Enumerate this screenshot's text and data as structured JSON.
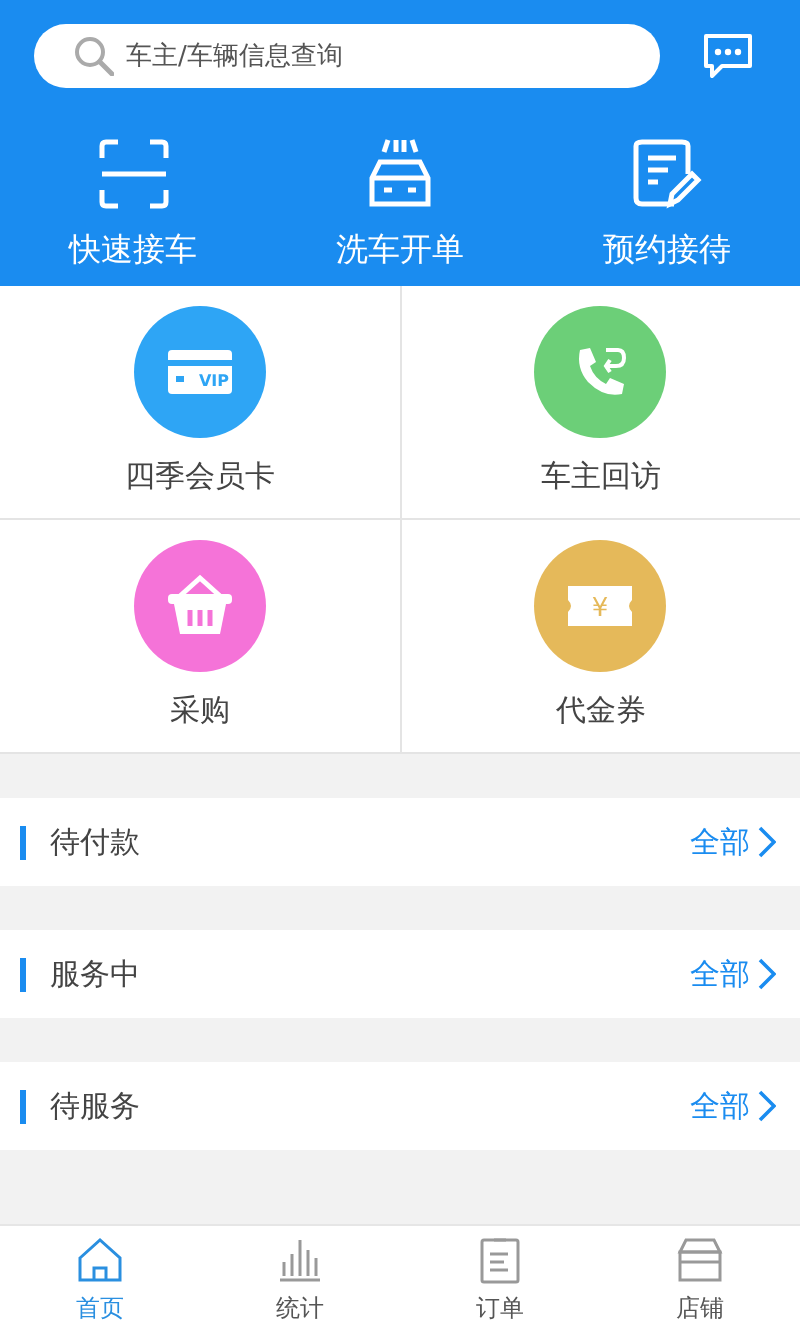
{
  "search": {
    "placeholder": "车主/车辆信息查询"
  },
  "quick_actions": [
    {
      "kind": "scan",
      "label": "快速接车"
    },
    {
      "kind": "carwash",
      "label": "洗车开单"
    },
    {
      "kind": "note",
      "label": "预约接待"
    }
  ],
  "grid": [
    {
      "kind": "vip",
      "label": "四季会员卡",
      "color": "#2ea5f5",
      "icon_text": "VIP"
    },
    {
      "kind": "phone",
      "label": "车主回访",
      "color": "#6ccf78"
    },
    {
      "kind": "basket",
      "label": "采购",
      "color": "#f573d8"
    },
    {
      "kind": "coupon",
      "label": "代金券",
      "color": "#e5b95a",
      "icon_text": "¥"
    }
  ],
  "sections": [
    {
      "title": "待付款",
      "link": "全部"
    },
    {
      "title": "服务中",
      "link": "全部"
    },
    {
      "title": "待服务",
      "link": "全部"
    }
  ],
  "tab_bar": [
    {
      "kind": "home",
      "label": "首页",
      "selected": true
    },
    {
      "kind": "stats",
      "label": "统计",
      "selected": false
    },
    {
      "kind": "order",
      "label": "订单",
      "selected": false
    },
    {
      "kind": "shop",
      "label": "店铺",
      "selected": false
    }
  ]
}
